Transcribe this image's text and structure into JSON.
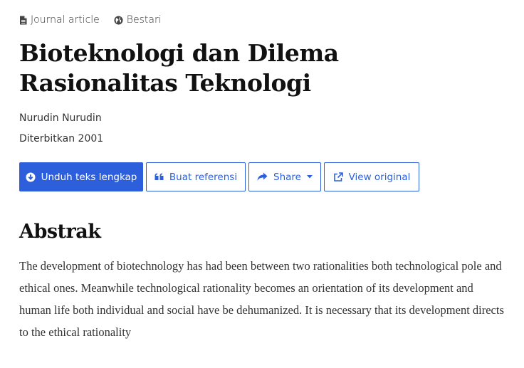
{
  "meta": {
    "type_label": "Journal article",
    "source_label": "Bestari"
  },
  "article": {
    "title": "Bioteknologi dan Dilema Rasionalitas Teknologi",
    "author": "Nurudin Nurudin",
    "published": "Diterbitkan 2001"
  },
  "actions": {
    "download_label": "Unduh teks lengkap",
    "cite_label": "Buat referensi",
    "share_label": "Share",
    "view_label": "View original"
  },
  "abstract": {
    "heading": "Abstrak",
    "text": "The development of biotechnology has had been between two rationalities both technological pole and ethical ones. Meanwhile technological rationality becomes an orientation of its development and human life both individual and social have be dehumanized. It is necessary that its development directs to the ethical rationality"
  },
  "colors": {
    "accent": "#2d5fdc",
    "text": "#333333",
    "heading": "#111111"
  },
  "icons": {
    "type": "document-icon",
    "source": "globe-icon",
    "download": "download-circle-icon",
    "cite": "quote-icon",
    "share": "share-arrow-icon",
    "share_caret": "caret-down-icon",
    "view": "external-link-icon"
  }
}
